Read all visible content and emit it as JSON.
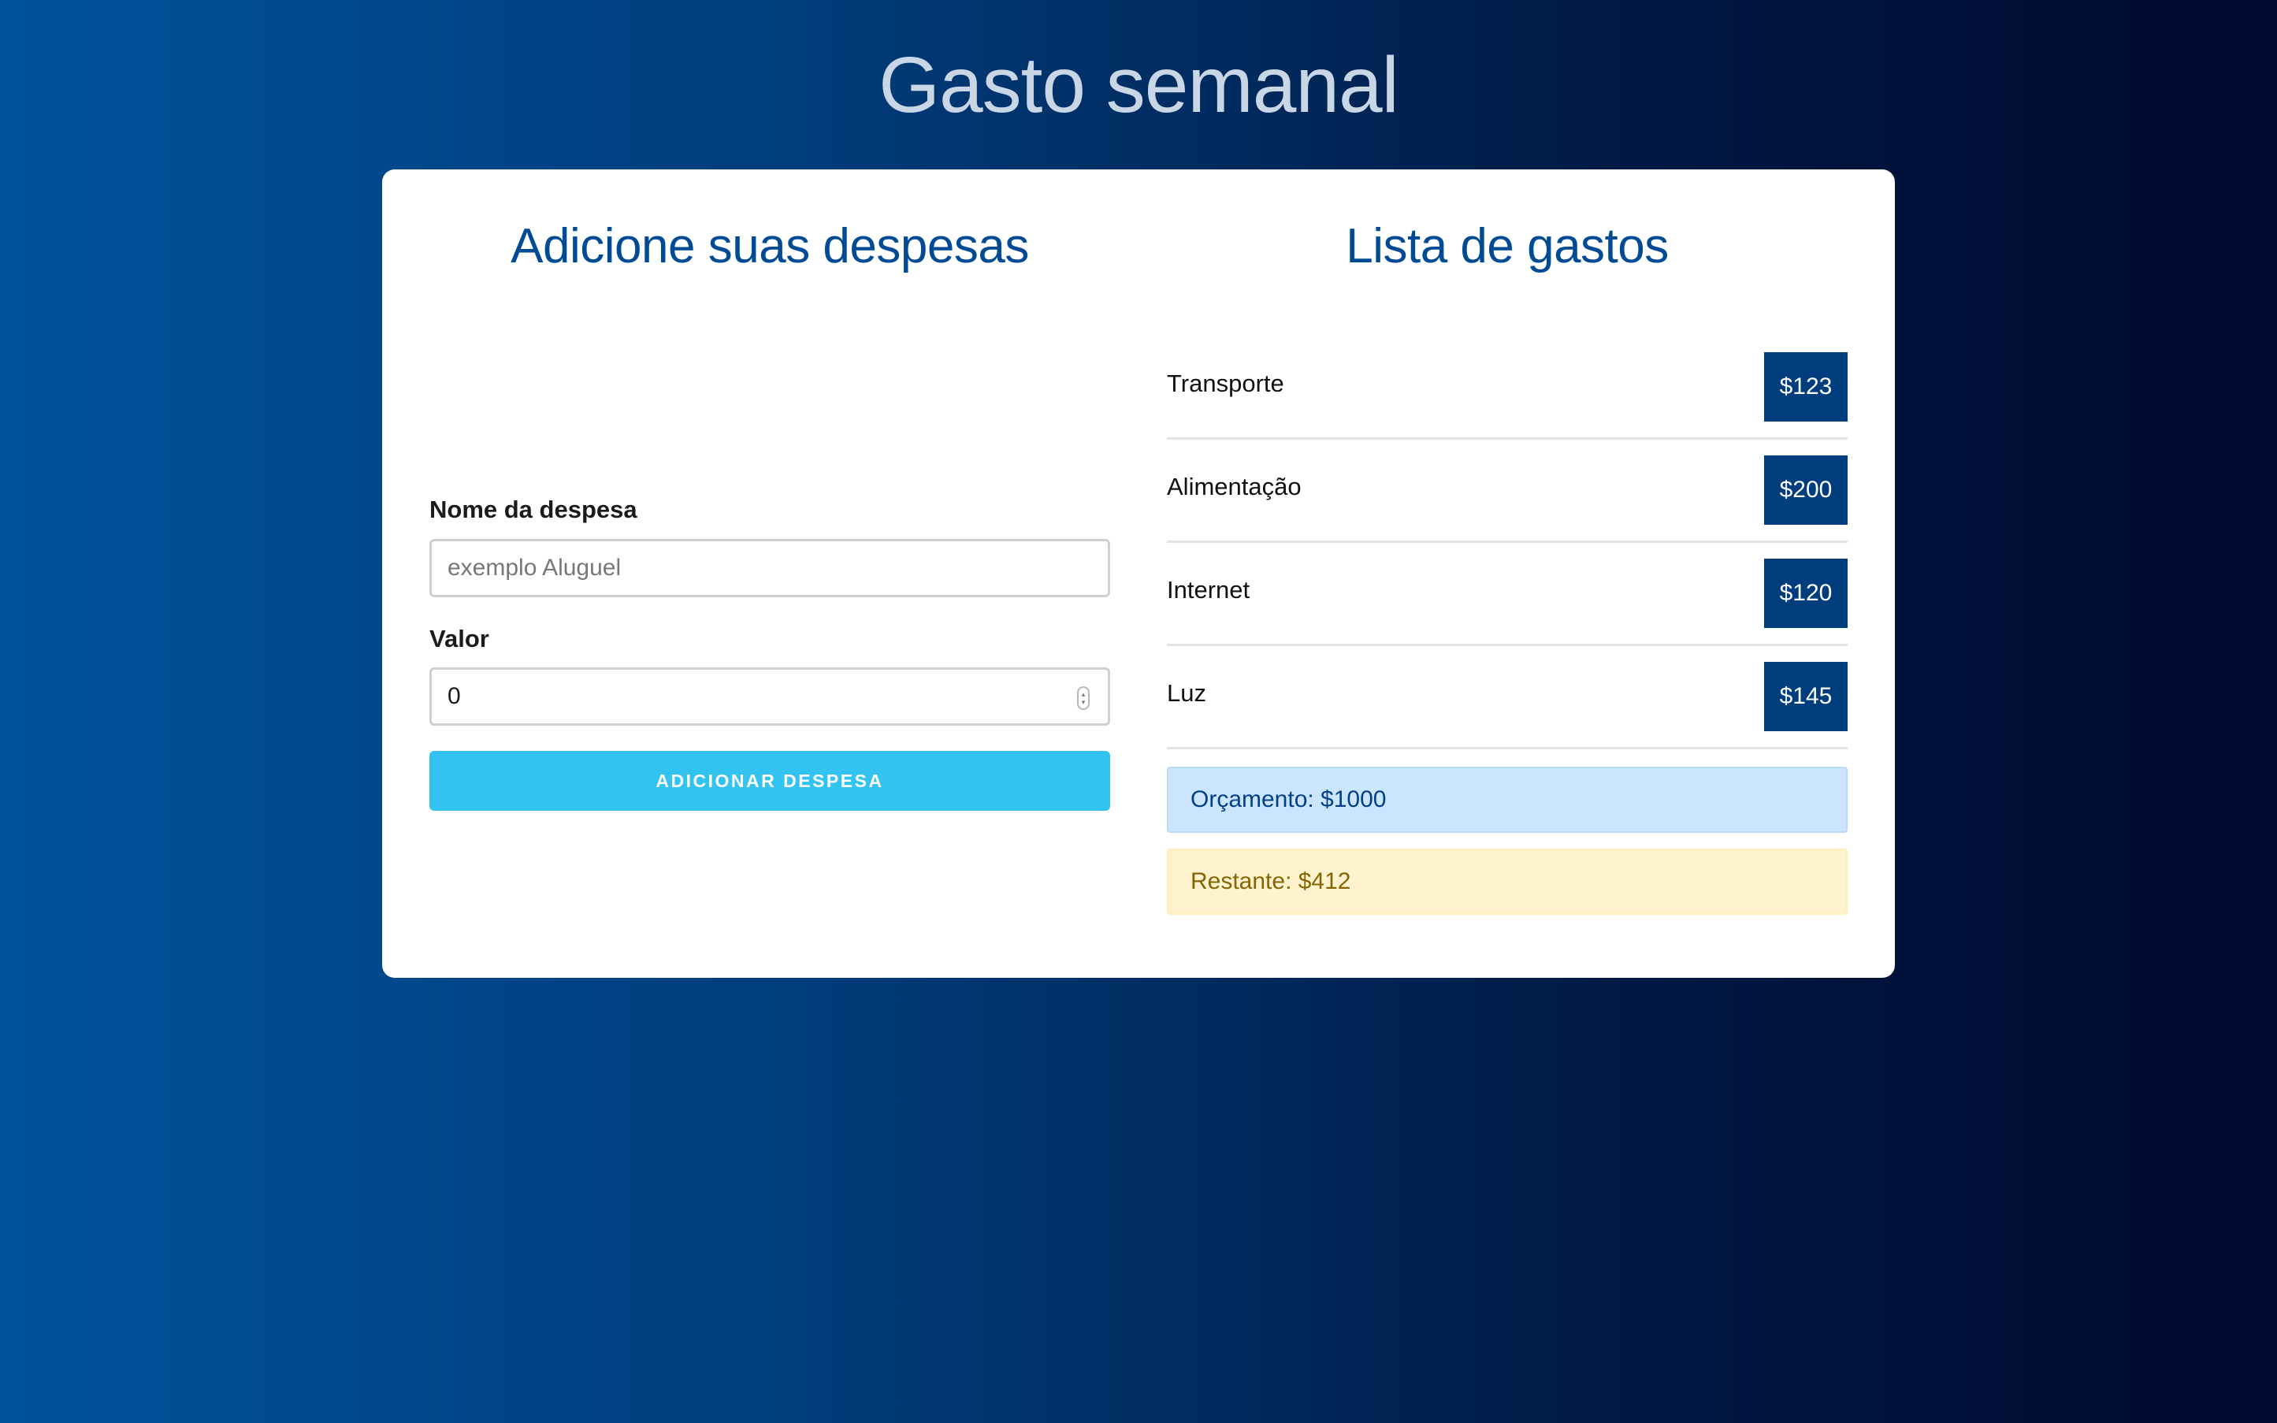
{
  "header": {
    "title": "Gasto semanal"
  },
  "form": {
    "heading": "Adicione suas despesas",
    "name_label": "Nome da despesa",
    "name_placeholder": "exemplo Aluguel",
    "name_value": "",
    "amount_label": "Valor",
    "amount_value": "0",
    "submit_label": "ADICIONAR DESPESA"
  },
  "list": {
    "heading": "Lista de gastos",
    "items": [
      {
        "name": "Transporte",
        "amount": "$123"
      },
      {
        "name": "Alimentação",
        "amount": "$200"
      },
      {
        "name": "Internet",
        "amount": "$120"
      },
      {
        "name": "Luz",
        "amount": "$145"
      }
    ],
    "budget": "Orçamento: $1000",
    "remaining": "Restante: $412"
  },
  "colors": {
    "primary": "#004b93",
    "badge": "#003d7c",
    "button": "#33c3f0",
    "budget_bg": "#cce5ff",
    "remaining_bg": "#fff3cd"
  },
  "icons": {
    "amount_stepper": "stepper-arrows-icon"
  }
}
